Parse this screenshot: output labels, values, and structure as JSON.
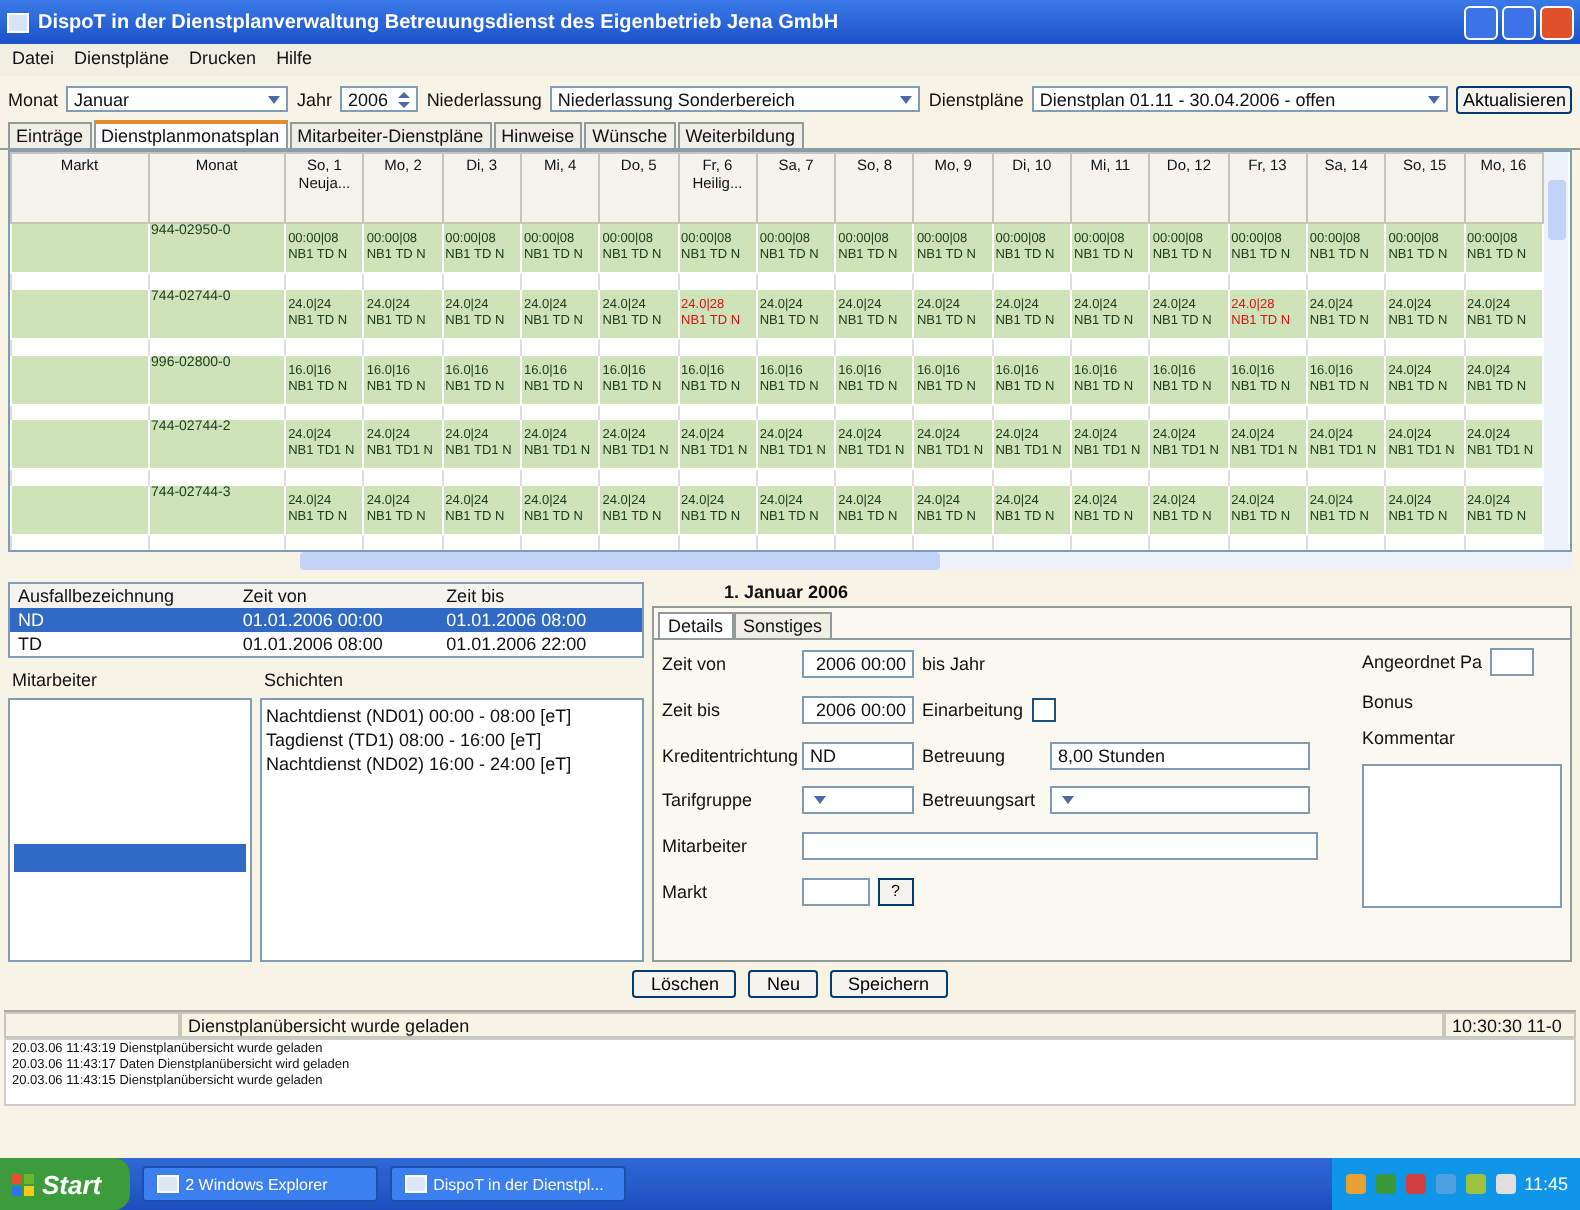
{
  "window": {
    "title": "DispoT in der Dienstplanverwaltung Betreuungsdienst des Eigenbetrieb Jena GmbH"
  },
  "menu": [
    "Datei",
    "Dienstpläne",
    "Drucken",
    "Hilfe"
  ],
  "toolbar": {
    "monat_label": "Monat",
    "monat": "Januar",
    "jahr_label": "Jahr",
    "jahr": "2006",
    "niederlassung_label": "Niederlassung",
    "niederlassung": "Niederlassung Sonderbereich",
    "dienstplan_label": "Dienstpläne",
    "dienstplan": "Dienstplan 01.11 - 30.04.2006 - offen",
    "button": "Aktualisieren"
  },
  "tabs": [
    {
      "label": "Einträge",
      "selected": false
    },
    {
      "label": "Dienstplanmonatsplan",
      "selected": true
    },
    {
      "label": "Mitarbeiter-Dienstpläne",
      "selected": false
    },
    {
      "label": "Hinweise",
      "selected": false
    },
    {
      "label": "Wünsche",
      "selected": false
    },
    {
      "label": "Weiterbildung",
      "selected": false
    }
  ],
  "grid": {
    "row_header_columns": [
      "Markt",
      "Monat"
    ],
    "columns": [
      "So, 1 Neuja...",
      "Mo, 2",
      "Di, 3",
      "Mi, 4",
      "Do, 5",
      "Fr, 6 Heilig...",
      "Sa, 7",
      "So, 8",
      "Mo, 9",
      "Di, 10",
      "Mi, 11",
      "Do, 12",
      "Fr, 13",
      "Sa, 14",
      "So, 15",
      "Mo, 16"
    ],
    "rows": [
      {
        "monat": "944-02950-0",
        "cells": [
          {
            "top": "00:00|08",
            "bottom": "NB1 TD N",
            "alert": false
          },
          {
            "top": "00:00|08",
            "bottom": "NB1 TD N",
            "alert": false
          },
          {
            "top": "00:00|08",
            "bottom": "NB1 TD N",
            "alert": false
          },
          {
            "top": "00:00|08",
            "bottom": "NB1 TD N",
            "alert": false
          },
          {
            "top": "00:00|08",
            "bottom": "NB1 TD N",
            "alert": false
          },
          {
            "top": "00:00|08",
            "bottom": "NB1 TD N",
            "alert": false
          },
          {
            "top": "00:00|08",
            "bottom": "NB1 TD N",
            "alert": false
          },
          {
            "top": "00:00|08",
            "bottom": "NB1 TD N",
            "alert": false
          },
          {
            "top": "00:00|08",
            "bottom": "NB1 TD N",
            "alert": false
          },
          {
            "top": "00:00|08",
            "bottom": "NB1 TD N",
            "alert": false
          },
          {
            "top": "00:00|08",
            "bottom": "NB1 TD N",
            "alert": false
          },
          {
            "top": "00:00|08",
            "bottom": "NB1 TD N",
            "alert": false
          },
          {
            "top": "00:00|08",
            "bottom": "NB1 TD N",
            "alert": false
          },
          {
            "top": "00:00|08",
            "bottom": "NB1 TD N",
            "alert": false
          },
          {
            "top": "00:00|08",
            "bottom": "NB1 TD N",
            "alert": false
          },
          {
            "top": "00:00|08",
            "bottom": "NB1 TD N",
            "alert": false
          }
        ]
      },
      {
        "monat": "744-02744-0",
        "cells": [
          {
            "top": "24.0|24",
            "bottom": "NB1 TD N",
            "alert": false
          },
          {
            "top": "24.0|24",
            "bottom": "NB1 TD N",
            "alert": false
          },
          {
            "top": "24.0|24",
            "bottom": "NB1 TD N",
            "alert": false
          },
          {
            "top": "24.0|24",
            "bottom": "NB1 TD N",
            "alert": false
          },
          {
            "top": "24.0|24",
            "bottom": "NB1 TD N",
            "alert": false
          },
          {
            "top": "24.0|28",
            "bottom": "NB1 TD N",
            "alert": true
          },
          {
            "top": "24.0|24",
            "bottom": "NB1 TD N",
            "alert": false
          },
          {
            "top": "24.0|24",
            "bottom": "NB1 TD N",
            "alert": false
          },
          {
            "top": "24.0|24",
            "bottom": "NB1 TD N",
            "alert": false
          },
          {
            "top": "24.0|24",
            "bottom": "NB1 TD N",
            "alert": false
          },
          {
            "top": "24.0|24",
            "bottom": "NB1 TD N",
            "alert": false
          },
          {
            "top": "24.0|24",
            "bottom": "NB1 TD N",
            "alert": false
          },
          {
            "top": "24.0|28",
            "bottom": "NB1 TD N",
            "alert": true
          },
          {
            "top": "24.0|24",
            "bottom": "NB1 TD N",
            "alert": false
          },
          {
            "top": "24.0|24",
            "bottom": "NB1 TD N",
            "alert": false
          },
          {
            "top": "24.0|24",
            "bottom": "NB1 TD N",
            "alert": false
          }
        ]
      },
      {
        "monat": "996-02800-0",
        "cells": [
          {
            "top": "16.0|16",
            "bottom": "NB1 TD N",
            "alert": false
          },
          {
            "top": "16.0|16",
            "bottom": "NB1 TD N",
            "alert": false
          },
          {
            "top": "16.0|16",
            "bottom": "NB1 TD N",
            "alert": false
          },
          {
            "top": "16.0|16",
            "bottom": "NB1 TD N",
            "alert": false
          },
          {
            "top": "16.0|16",
            "bottom": "NB1 TD N",
            "alert": false
          },
          {
            "top": "16.0|16",
            "bottom": "NB1 TD N",
            "alert": false
          },
          {
            "top": "16.0|16",
            "bottom": "NB1 TD N",
            "alert": false
          },
          {
            "top": "16.0|16",
            "bottom": "NB1 TD N",
            "alert": false
          },
          {
            "top": "16.0|16",
            "bottom": "NB1 TD N",
            "alert": false
          },
          {
            "top": "16.0|16",
            "bottom": "NB1 TD N",
            "alert": false
          },
          {
            "top": "16.0|16",
            "bottom": "NB1 TD N",
            "alert": false
          },
          {
            "top": "16.0|16",
            "bottom": "NB1 TD N",
            "alert": false
          },
          {
            "top": "16.0|16",
            "bottom": "NB1 TD N",
            "alert": false
          },
          {
            "top": "16.0|16",
            "bottom": "NB1 TD N",
            "alert": false
          },
          {
            "top": "24.0|24",
            "bottom": "NB1 TD N",
            "alert": false
          },
          {
            "top": "24.0|24",
            "bottom": "NB1 TD N",
            "alert": false
          }
        ]
      },
      {
        "monat": "744-02744-2",
        "cells": [
          {
            "top": "24.0|24",
            "bottom": "NB1 TD1 N",
            "alert": false
          },
          {
            "top": "24.0|24",
            "bottom": "NB1 TD1 N",
            "alert": false
          },
          {
            "top": "24.0|24",
            "bottom": "NB1 TD1 N",
            "alert": false
          },
          {
            "top": "24.0|24",
            "bottom": "NB1 TD1 N",
            "alert": false
          },
          {
            "top": "24.0|24",
            "bottom": "NB1 TD1 N",
            "alert": false
          },
          {
            "top": "24.0|24",
            "bottom": "NB1 TD1 N",
            "alert": false
          },
          {
            "top": "24.0|24",
            "bottom": "NB1 TD1 N",
            "alert": false
          },
          {
            "top": "24.0|24",
            "bottom": "NB1 TD1 N",
            "alert": false
          },
          {
            "top": "24.0|24",
            "bottom": "NB1 TD1 N",
            "alert": false
          },
          {
            "top": "24.0|24",
            "bottom": "NB1 TD1 N",
            "alert": false
          },
          {
            "top": "24.0|24",
            "bottom": "NB1 TD1 N",
            "alert": false
          },
          {
            "top": "24.0|24",
            "bottom": "NB1 TD1 N",
            "alert": false
          },
          {
            "top": "24.0|24",
            "bottom": "NB1 TD1 N",
            "alert": false
          },
          {
            "top": "24.0|24",
            "bottom": "NB1 TD1 N",
            "alert": false
          },
          {
            "top": "24.0|24",
            "bottom": "NB1 TD1 N",
            "alert": false
          },
          {
            "top": "24.0|24",
            "bottom": "NB1 TD1 N",
            "alert": false
          }
        ]
      },
      {
        "monat": "744-02744-3",
        "cells": [
          {
            "top": "24.0|24",
            "bottom": "NB1 TD N",
            "alert": false
          },
          {
            "top": "24.0|24",
            "bottom": "NB1 TD N",
            "alert": false
          },
          {
            "top": "24.0|24",
            "bottom": "NB1 TD N",
            "alert": false
          },
          {
            "top": "24.0|24",
            "bottom": "NB1 TD N",
            "alert": false
          },
          {
            "top": "24.0|24",
            "bottom": "NB1 TD N",
            "alert": false
          },
          {
            "top": "24.0|24",
            "bottom": "NB1 TD N",
            "alert": false
          },
          {
            "top": "24.0|24",
            "bottom": "NB1 TD N",
            "alert": false
          },
          {
            "top": "24.0|24",
            "bottom": "NB1 TD N",
            "alert": false
          },
          {
            "top": "24.0|24",
            "bottom": "NB1 TD N",
            "alert": false
          },
          {
            "top": "24.0|24",
            "bottom": "NB1 TD N",
            "alert": false
          },
          {
            "top": "24.0|24",
            "bottom": "NB1 TD N",
            "alert": false
          },
          {
            "top": "24.0|24",
            "bottom": "NB1 TD N",
            "alert": false
          },
          {
            "top": "24.0|24",
            "bottom": "NB1 TD N",
            "alert": false
          },
          {
            "top": "24.0|24",
            "bottom": "NB1 TD N",
            "alert": false
          },
          {
            "top": "24.0|24",
            "bottom": "NB1 TD N",
            "alert": false
          },
          {
            "top": "24.0|24",
            "bottom": "NB1 TD N",
            "alert": false
          }
        ]
      }
    ]
  },
  "ausfall": {
    "columns": [
      "Ausfallbezeichnung",
      "Zeit von",
      "Zeit bis"
    ],
    "rows": [
      {
        "cells": [
          "ND",
          "01.01.2006 00:00",
          "01.01.2006 08:00"
        ],
        "selected": true
      },
      {
        "cells": [
          "TD",
          "01.01.2006 08:00",
          "01.01.2006 22:00"
        ],
        "selected": false
      }
    ]
  },
  "mitarbeiter": {
    "label": "Mitarbeiter",
    "items": [
      {
        "selected": false
      },
      {
        "selected": false
      },
      {
        "selected": false
      },
      {
        "selected": false
      },
      {
        "selected": false
      },
      {
        "selected": true
      }
    ]
  },
  "schichten": {
    "label": "Schichten",
    "items": [
      "Nachtdienst (ND01) 00:00 - 08:00 [eT]",
      "Tagdienst (TD1) 08:00 - 16:00 [eT]",
      "Nachtdienst (ND02) 16:00 - 24:00 [eT]"
    ]
  },
  "detail": {
    "date": "1. Januar 2006",
    "tabs": [
      {
        "label": "Details",
        "selected": true
      },
      {
        "label": "Sonstiges",
        "selected": false
      }
    ],
    "zeit_von_label": "Zeit von",
    "zeit_von": "2006 00:00",
    "bis_label": "bis Jahr",
    "zeit_bis_label": "Zeit bis",
    "zeit_bis": "2006 00:00",
    "einarbeitung_label": "Einarbeitung",
    "einarbeitung_checked": false,
    "kredit_label": "Kreditentrichtung",
    "kredit": "ND",
    "betreuung_label": "Betreuung",
    "betreuung": "8,00 Stunden",
    "tarif_label": "Tarifgruppe",
    "betreuungsart_label": "Betreuungsart",
    "mitarbeiter_label": "Mitarbeiter",
    "markt_label": "Markt",
    "markt_button": "?",
    "angeordnet_label": "Angeordnet Pa",
    "bonus_label": "Bonus",
    "kommentar_label": "Kommentar"
  },
  "buttons": [
    "Löschen",
    "Neu",
    "Speichern"
  ],
  "status_bar": {
    "message": "Dienstplanübersicht wurde geladen",
    "time": "10:30:30 11-0"
  },
  "log": [
    "20.03.06 11:43:19 Dienstplanübersicht wurde geladen",
    "20.03.06 11:43:17 Daten Dienstplanübersicht wird geladen",
    "20.03.06 11:43:15 Dienstplanübersicht wurde geladen"
  ],
  "taskbar": {
    "start": "Start",
    "tasks": [
      "2 Windows Explorer",
      "DispoT in der Dienstpl..."
    ],
    "clock": "11:45"
  }
}
